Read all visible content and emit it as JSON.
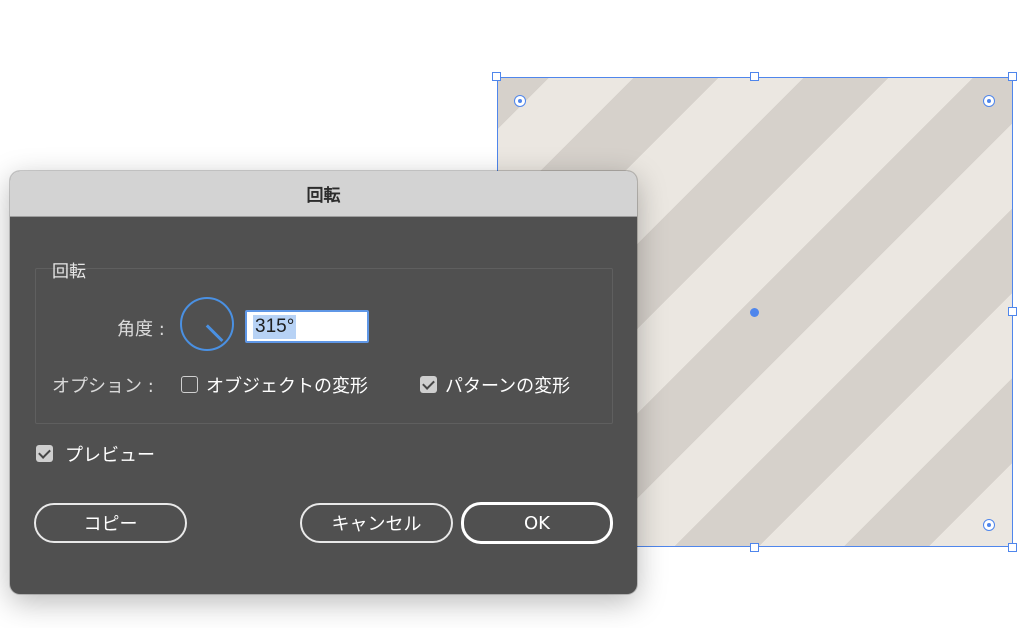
{
  "dialog": {
    "title": "回転",
    "group_title": "回転",
    "angle_label": "角度 :",
    "angle_value": "315°",
    "angle_degrees": 315,
    "options_label": "オプション :",
    "options": [
      {
        "label": "オブジェクトの変形",
        "checked": false
      },
      {
        "label": "パターンの変形",
        "checked": true
      }
    ],
    "preview": {
      "label": "プレビュー",
      "checked": true
    },
    "buttons": {
      "copy": "コピー",
      "cancel": "キャンセル",
      "ok": "OK"
    }
  },
  "artwork": {
    "stripe_light": "#ebe7e1",
    "stripe_dark": "#d6d1cb",
    "selection_color": "#4f86ec"
  },
  "icons": [
    "angle-dial-icon",
    "checkbox-checked-icon",
    "checkbox-unchecked-icon",
    "center-point-icon",
    "corner-widget-icon"
  ]
}
